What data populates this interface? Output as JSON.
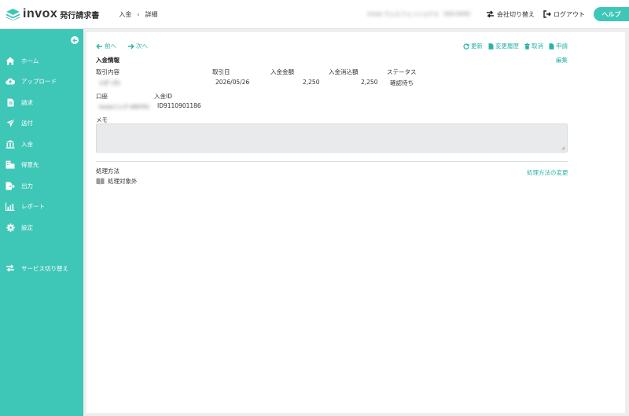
{
  "header": {
    "logo_text": "invox",
    "logo_sub": "発行請求書",
    "breadcrumb": [
      "入金",
      "詳細"
    ],
    "breadcrumb_sep": "›",
    "company_name": "invox ウェルフェッショナル",
    "company_id": "000-0000",
    "switch_company": "会社切り替え",
    "logout": "ログアウト",
    "help": "ヘルプ"
  },
  "sidebar": {
    "items": [
      {
        "label": "ホーム",
        "icon": "home-icon"
      },
      {
        "label": "アップロード",
        "icon": "cloud-upload-icon"
      },
      {
        "label": "請求",
        "icon": "document-icon"
      },
      {
        "label": "送付",
        "icon": "paper-plane-icon"
      },
      {
        "label": "入金",
        "icon": "bank-icon"
      },
      {
        "label": "得意先",
        "icon": "building-icon"
      },
      {
        "label": "出力",
        "icon": "export-icon"
      },
      {
        "label": "レポート",
        "icon": "chart-icon"
      },
      {
        "label": "設定",
        "icon": "gear-icon"
      }
    ],
    "service_switch": "サービス切り替え"
  },
  "main": {
    "prev": "前へ",
    "next": "次へ",
    "actions": {
      "refresh": "更新",
      "history": "変更履歴",
      "cancel": "取消",
      "apply": "申請"
    },
    "section_title": "入金情報",
    "edit": "編集",
    "table": {
      "headers": [
        "取引内容",
        "取引日",
        "入金金額",
        "入金消込額",
        "ステータス"
      ],
      "values": [
        "ｲﾝﾎﾞｯｸｽ",
        "2026/05/26",
        "2,250",
        "2,250",
        "確認待ち"
      ]
    },
    "account_label": "口座",
    "account_value": "invoxバンク 000701",
    "payment_id_label": "入金ID",
    "payment_id_value": "ID9110901186",
    "memo_label": "メモ",
    "process_label": "処理方法",
    "process_value": "処理対象外",
    "process_change": "処理方法の変更"
  },
  "colors": {
    "accent": "#3ec6b6",
    "link": "#2bb3a4"
  }
}
